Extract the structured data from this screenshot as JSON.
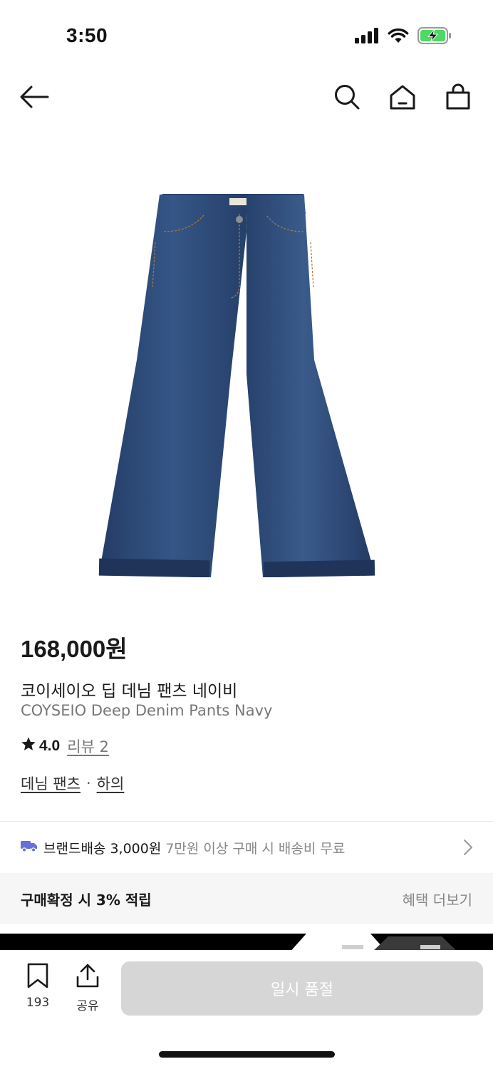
{
  "status_bar": {
    "time": "3:50",
    "icons": [
      "signal-icon",
      "wifi-icon",
      "battery-charging-icon"
    ],
    "battery_color": "#4cd964"
  },
  "nav": {
    "icons": [
      "back-arrow-icon",
      "search-icon",
      "home-icon",
      "shopping-bag-icon"
    ]
  },
  "product": {
    "image_icon": "denim-pants-image",
    "denim_color": "#2e4a78",
    "price": "168,000원",
    "name_ko": "코이세이오 딥 데님 팬츠 네이비",
    "name_en": "COYSEIO Deep Denim Pants Navy",
    "rating": "4.0",
    "review_label": "리뷰 2",
    "categories": [
      "데님 팬츠",
      "하의"
    ],
    "category_separator": "·"
  },
  "shipping": {
    "icon": "truck-icon",
    "icon_color": "#6a6fd8",
    "title": "브랜드배송 3,000원",
    "description": "7만원 이상 구매 시 배송비 무료"
  },
  "benefit": {
    "title": "구매확정 시 3% 적립",
    "link": "혜택 더보기"
  },
  "bottom_bar": {
    "bookmark_count": "193",
    "share_label": "공유",
    "main_button_label": "일시 품절",
    "main_button_color": "#d6d6d6"
  }
}
